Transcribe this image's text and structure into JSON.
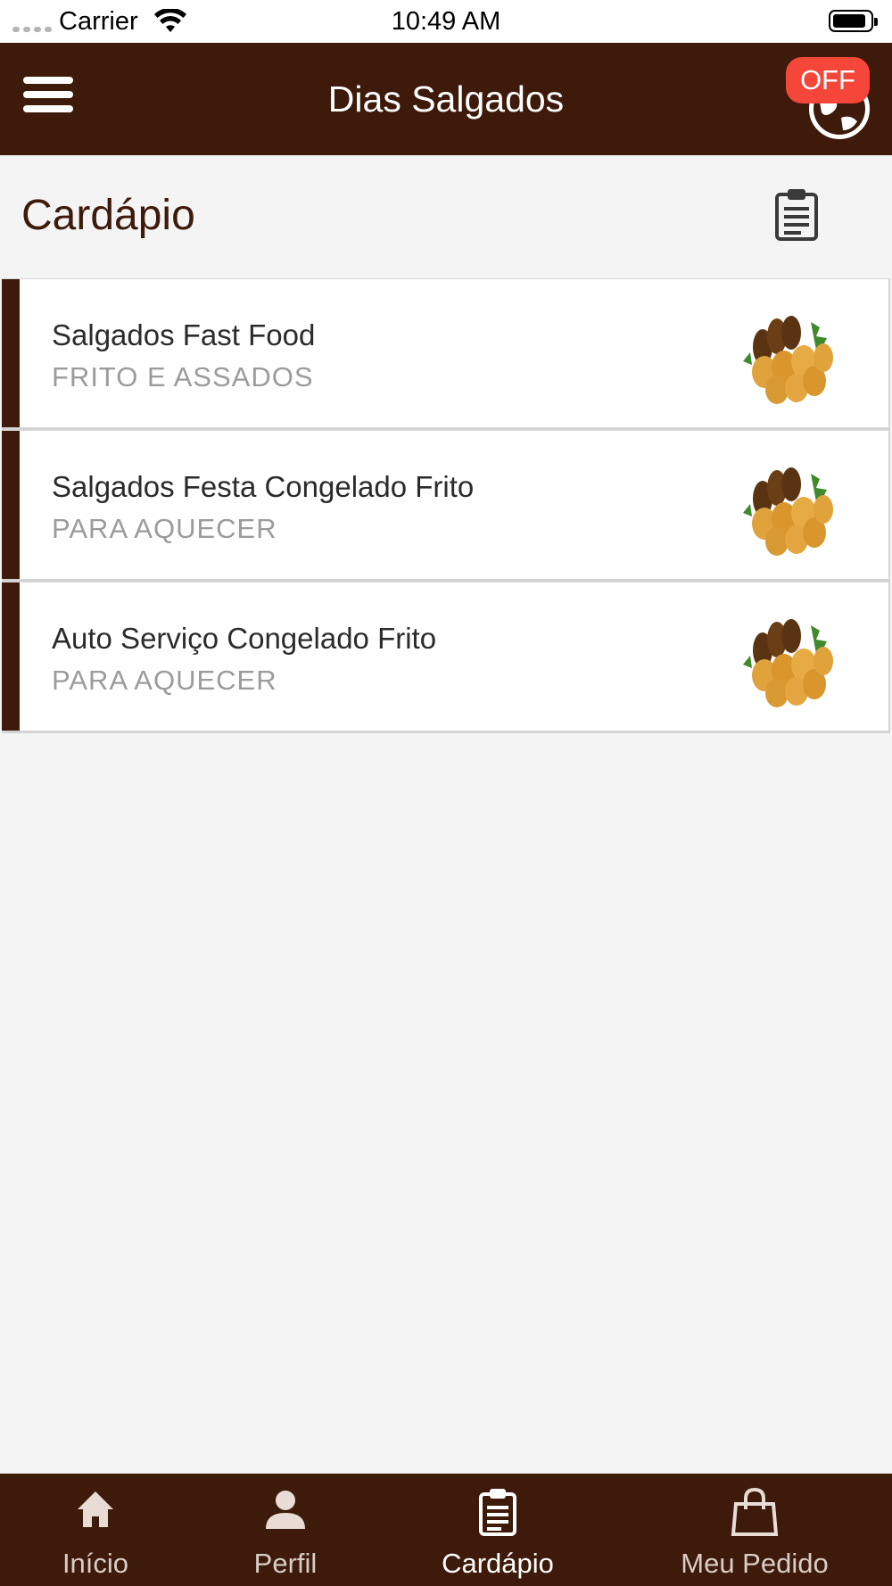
{
  "status_bar": {
    "carrier": "Carrier",
    "time": "10:49 AM"
  },
  "header": {
    "title": "Dias Salgados",
    "status_badge": "OFF",
    "background_color": "#3d1a0a",
    "badge_color": "#f4473a"
  },
  "page": {
    "title": "Cardápio"
  },
  "categories": [
    {
      "name": "Salgados Fast Food",
      "subtitle": "FRITO E ASSADOS"
    },
    {
      "name": "Salgados Festa Congelado Frito",
      "subtitle": "PARA AQUECER"
    },
    {
      "name": "Auto Serviço Congelado Frito",
      "subtitle": "PARA AQUECER"
    }
  ],
  "tabs": [
    {
      "label": "Início",
      "icon": "home-icon"
    },
    {
      "label": "Perfil",
      "icon": "person-icon"
    },
    {
      "label": "Cardápio",
      "icon": "clipboard-icon",
      "active": true
    },
    {
      "label": "Meu Pedido",
      "icon": "shopping-bag-icon"
    }
  ]
}
